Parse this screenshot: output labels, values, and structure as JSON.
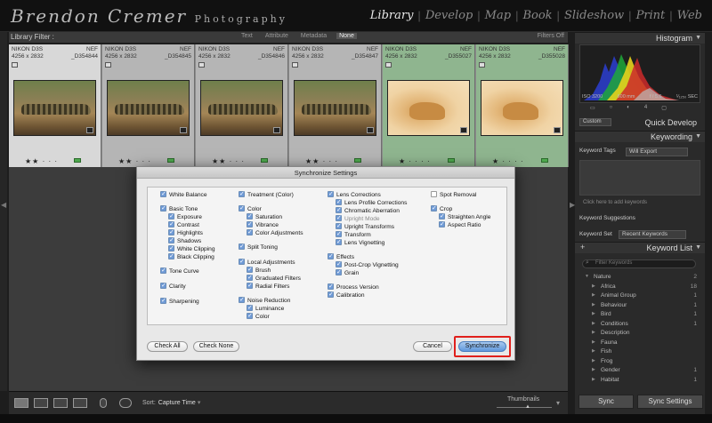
{
  "brand": {
    "name": "Brendon Cremer",
    "sub": "Photography"
  },
  "modules": [
    "Library",
    "Develop",
    "Map",
    "Book",
    "Slideshow",
    "Print",
    "Web"
  ],
  "filter_bar": {
    "label": "Library Filter :",
    "tabs": [
      "Text",
      "Attribute",
      "Metadata",
      "None"
    ],
    "active_tab": "None",
    "right": "Filters Off"
  },
  "grid": {
    "cells": [
      {
        "camera": "NIKON D3S",
        "type": "NEF",
        "dims": "4256 x 2832",
        "file": "_D354844",
        "stars": "★★ · · ·",
        "state": "sel1",
        "subject": "croc"
      },
      {
        "camera": "NIKON D3S",
        "type": "NEF",
        "dims": "4256 x 2832",
        "file": "_D354845",
        "stars": "★★ · · ·",
        "state": "sel2",
        "subject": "croc"
      },
      {
        "camera": "NIKON D3S",
        "type": "NEF",
        "dims": "4256 x 2832",
        "file": "_D354846",
        "stars": "★★ · · ·",
        "state": "sel2",
        "subject": "croc"
      },
      {
        "camera": "NIKON D3S",
        "type": "NEF",
        "dims": "4256 x 2832",
        "file": "_D354847",
        "stars": "★★ · · ·",
        "state": "sel2",
        "subject": "croc"
      },
      {
        "camera": "NIKON D3S",
        "type": "NEF",
        "dims": "4256 x 2832",
        "file": "_D355027",
        "stars": "★ · · · ·",
        "state": "green",
        "subject": "lion"
      },
      {
        "camera": "NIKON D3S",
        "type": "NEF",
        "dims": "4256 x 2832",
        "file": "_D355028",
        "stars": "★ · · · ·",
        "state": "green",
        "subject": "lion"
      }
    ]
  },
  "toolbar": {
    "sort_label": "Sort:",
    "sort_value": "Capture Time",
    "thumbnails_label": "Thumbnails"
  },
  "right_panel": {
    "histogram_title": "Histogram",
    "histogram_info": [
      "ISO 3200",
      "600 mm",
      "f / 5.6",
      "¹⁄₁₂₅₀ SEC"
    ],
    "histogram_icons": [
      "▭",
      "○",
      "◐",
      "4",
      "▢"
    ],
    "quick_develop_preset": "Custom",
    "quick_develop_title": "Quick Develop",
    "keywording_title": "Keywording",
    "keyword_tags_label": "Keyword Tags",
    "keyword_tags_value": "Will Export",
    "keyword_click_hint": "Click here to add keywords",
    "keyword_suggestions": "Keyword Suggestions",
    "keyword_set_label": "Keyword Set",
    "keyword_set_value": "Recent Keywords",
    "keyword_list_title": "Keyword List",
    "keyword_filter_placeholder": "Filter Keywords",
    "keywords": [
      {
        "name": "Nature",
        "count": "2",
        "level": 0,
        "open": true
      },
      {
        "name": "Africa",
        "count": "18",
        "level": 1
      },
      {
        "name": "Animal Group",
        "count": "1",
        "level": 1
      },
      {
        "name": "Behaviour",
        "count": "1",
        "level": 1
      },
      {
        "name": "Bird",
        "count": "1",
        "level": 1
      },
      {
        "name": "Conditions",
        "count": "1",
        "level": 1
      },
      {
        "name": "Description",
        "count": "",
        "level": 1
      },
      {
        "name": "Fauna",
        "count": "",
        "level": 1
      },
      {
        "name": "Fish",
        "count": "",
        "level": 1
      },
      {
        "name": "Frog",
        "count": "",
        "level": 1
      },
      {
        "name": "Gender",
        "count": "1",
        "level": 1
      },
      {
        "name": "Habitat",
        "count": "1",
        "level": 1
      }
    ],
    "sync_label": "Sync",
    "sync_settings_label": "Sync Settings"
  },
  "dialog": {
    "title": "Synchronize Settings",
    "col1": [
      {
        "label": "White Balance",
        "checked": true,
        "indent": 0
      },
      {
        "label": "Basic Tone",
        "checked": true,
        "indent": 0
      },
      {
        "label": "Exposure",
        "checked": true,
        "indent": 1
      },
      {
        "label": "Contrast",
        "checked": true,
        "indent": 1
      },
      {
        "label": "Highlights",
        "checked": true,
        "indent": 1
      },
      {
        "label": "Shadows",
        "checked": true,
        "indent": 1
      },
      {
        "label": "White Clipping",
        "checked": true,
        "indent": 1
      },
      {
        "label": "Black Clipping",
        "checked": true,
        "indent": 1
      },
      {
        "label": "Tone Curve",
        "checked": true,
        "indent": 0
      },
      {
        "label": "Clarity",
        "checked": true,
        "indent": 0
      },
      {
        "label": "Sharpening",
        "checked": true,
        "indent": 0
      }
    ],
    "col2": [
      {
        "label": "Treatment (Color)",
        "checked": true,
        "indent": 0
      },
      {
        "label": "Color",
        "checked": true,
        "indent": 0
      },
      {
        "label": "Saturation",
        "checked": true,
        "indent": 1
      },
      {
        "label": "Vibrance",
        "checked": true,
        "indent": 1
      },
      {
        "label": "Color Adjustments",
        "checked": true,
        "indent": 1
      },
      {
        "label": "Split Toning",
        "checked": true,
        "indent": 0
      },
      {
        "label": "Local Adjustments",
        "checked": true,
        "indent": 0
      },
      {
        "label": "Brush",
        "checked": true,
        "indent": 1
      },
      {
        "label": "Graduated Filters",
        "checked": true,
        "indent": 1
      },
      {
        "label": "Radial Filters",
        "checked": true,
        "indent": 1
      },
      {
        "label": "Noise Reduction",
        "checked": true,
        "indent": 0
      },
      {
        "label": "Luminance",
        "checked": true,
        "indent": 1
      },
      {
        "label": "Color",
        "checked": true,
        "indent": 1
      }
    ],
    "col3": [
      {
        "label": "Lens Corrections",
        "checked": true,
        "indent": 0
      },
      {
        "label": "Lens Profile Corrections",
        "checked": true,
        "indent": 1
      },
      {
        "label": "Chromatic Aberration",
        "checked": true,
        "indent": 1
      },
      {
        "label": "Upright Mode",
        "checked": true,
        "indent": 1,
        "dim": true
      },
      {
        "label": "Upright Transforms",
        "checked": true,
        "indent": 1
      },
      {
        "label": "Transform",
        "checked": true,
        "indent": 1
      },
      {
        "label": "Lens Vignetting",
        "checked": true,
        "indent": 1
      },
      {
        "label": "Effects",
        "checked": true,
        "indent": 0
      },
      {
        "label": "Post-Crop Vignetting",
        "checked": true,
        "indent": 1
      },
      {
        "label": "Grain",
        "checked": true,
        "indent": 1
      },
      {
        "label": "Process Version",
        "checked": true,
        "indent": 0
      },
      {
        "label": "Calibration",
        "checked": true,
        "indent": 0
      }
    ],
    "col4": [
      {
        "label": "Spot Removal",
        "checked": false,
        "indent": 0
      },
      {
        "label": "Crop",
        "checked": true,
        "indent": 0
      },
      {
        "label": "Straighten Angle",
        "checked": true,
        "indent": 1
      },
      {
        "label": "Aspect Ratio",
        "checked": true,
        "indent": 1
      }
    ],
    "check_all": "Check All",
    "check_none": "Check None",
    "cancel": "Cancel",
    "synchronize": "Synchronize"
  },
  "colors": {
    "highlight_border": "#e0201c",
    "selected_green": "#8fb58f",
    "checkbox_blue": "#6f9ad6"
  }
}
